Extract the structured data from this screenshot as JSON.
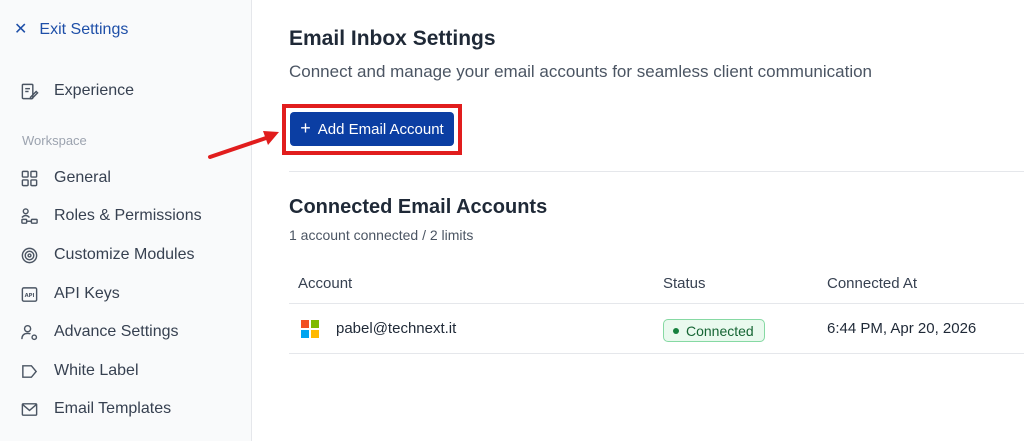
{
  "sidebar": {
    "exit_label": "Exit Settings",
    "experience": "Experience",
    "section_label": "Workspace",
    "items": [
      {
        "label": "General",
        "icon": "grid-icon"
      },
      {
        "label": "Roles & Permissions",
        "icon": "users-hierarchy-icon"
      },
      {
        "label": "Customize Modules",
        "icon": "target-icon"
      },
      {
        "label": "API Keys",
        "icon": "api-icon"
      },
      {
        "label": "Advance Settings",
        "icon": "user-gear-icon"
      },
      {
        "label": "White Label",
        "icon": "tag-icon"
      },
      {
        "label": "Email Templates",
        "icon": "mail-icon"
      }
    ]
  },
  "main": {
    "title": "Email Inbox Settings",
    "subtitle": "Connect and manage your email accounts for seamless client communication",
    "add_button": "Add Email Account",
    "connected_title": "Connected Email Accounts",
    "connected_sub": "1 account connected / 2 limits",
    "table": {
      "headers": [
        "Account",
        "Status",
        "Connected At"
      ],
      "rows": [
        {
          "account": "pabel@technext.it",
          "provider_icon": "microsoft-icon",
          "status": "Connected",
          "connected_at": "6:44 PM, Apr 20, 2026"
        }
      ]
    }
  },
  "colors": {
    "accent": "#0b3ea3",
    "link": "#1e4fa8",
    "highlight": "#e11d1d",
    "status_green": "#15803d"
  }
}
